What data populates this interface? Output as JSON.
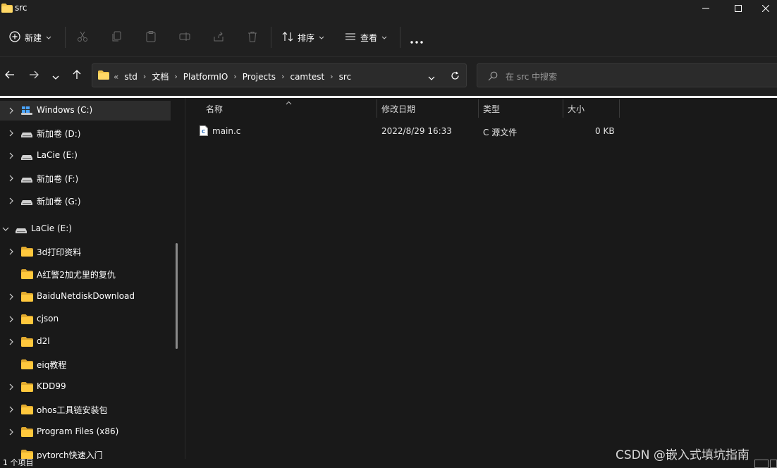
{
  "window": {
    "title": "src"
  },
  "toolbar": {
    "new_label": "新建",
    "sort_label": "排序",
    "view_label": "查看",
    "icons": [
      "plus-icon",
      "cut-icon",
      "copy-icon",
      "paste-icon",
      "rename-icon",
      "share-icon",
      "delete-icon",
      "sort-icon",
      "view-icon",
      "more-icon"
    ]
  },
  "address": {
    "overflow": "«",
    "crumbs": [
      "std",
      "文档",
      "PlatformIO",
      "Projects",
      "camtest",
      "src"
    ],
    "search_placeholder": "在 src 中搜索"
  },
  "sidebar": {
    "items": [
      {
        "label": "Windows (C:)",
        "icon": "windows-drive-icon",
        "expanded": false,
        "selected": true,
        "has_chevron": true,
        "indent": 1
      },
      {
        "label": "新加卷 (D:)",
        "icon": "drive-icon",
        "expanded": false,
        "selected": false,
        "has_chevron": true,
        "indent": 1
      },
      {
        "label": "LaCie  (E:)",
        "icon": "drive-icon",
        "expanded": false,
        "selected": false,
        "has_chevron": true,
        "indent": 1
      },
      {
        "label": "新加卷 (F:)",
        "icon": "drive-icon",
        "expanded": false,
        "selected": false,
        "has_chevron": true,
        "indent": 1
      },
      {
        "label": "新加卷 (G:)",
        "icon": "drive-icon",
        "expanded": false,
        "selected": false,
        "has_chevron": true,
        "indent": 1
      },
      {
        "label": "LaCie  (E:)",
        "icon": "drive-icon",
        "expanded": true,
        "selected": false,
        "has_chevron": true,
        "indent": 0
      },
      {
        "label": "3d打印资料",
        "icon": "folder-icon",
        "expanded": false,
        "selected": false,
        "has_chevron": true,
        "indent": 1
      },
      {
        "label": "A红警2加尤里的复仇",
        "icon": "folder-icon",
        "expanded": false,
        "selected": false,
        "has_chevron": false,
        "indent": 1
      },
      {
        "label": "BaiduNetdiskDownload",
        "icon": "folder-icon",
        "expanded": false,
        "selected": false,
        "has_chevron": true,
        "indent": 1
      },
      {
        "label": "cjson",
        "icon": "folder-icon",
        "expanded": false,
        "selected": false,
        "has_chevron": true,
        "indent": 1
      },
      {
        "label": "d2l",
        "icon": "folder-icon",
        "expanded": false,
        "selected": false,
        "has_chevron": true,
        "indent": 1
      },
      {
        "label": "eiq教程",
        "icon": "folder-icon",
        "expanded": false,
        "selected": false,
        "has_chevron": false,
        "indent": 1
      },
      {
        "label": "KDD99",
        "icon": "folder-icon",
        "expanded": false,
        "selected": false,
        "has_chevron": true,
        "indent": 1
      },
      {
        "label": "ohos工具链安装包",
        "icon": "folder-icon",
        "expanded": false,
        "selected": false,
        "has_chevron": true,
        "indent": 1
      },
      {
        "label": "Program Files (x86)",
        "icon": "folder-icon",
        "expanded": false,
        "selected": false,
        "has_chevron": true,
        "indent": 1
      },
      {
        "label": "pytorch快速入门",
        "icon": "folder-icon",
        "expanded": false,
        "selected": false,
        "has_chevron": false,
        "indent": 1
      }
    ]
  },
  "filelist": {
    "columns": [
      "名称",
      "修改日期",
      "类型",
      "大小"
    ],
    "files": [
      {
        "name": "main.c",
        "modified": "2022/8/29 16:33",
        "type": "C 源文件",
        "size": "0 KB",
        "icon": "c-file-icon"
      }
    ]
  },
  "status": {
    "text": "1 个项目"
  },
  "watermark": "CSDN @嵌入式填坑指南",
  "colors": {
    "background": "#191919",
    "panel": "#202020",
    "folder": "#f0c44c",
    "text": "#ffffff"
  }
}
